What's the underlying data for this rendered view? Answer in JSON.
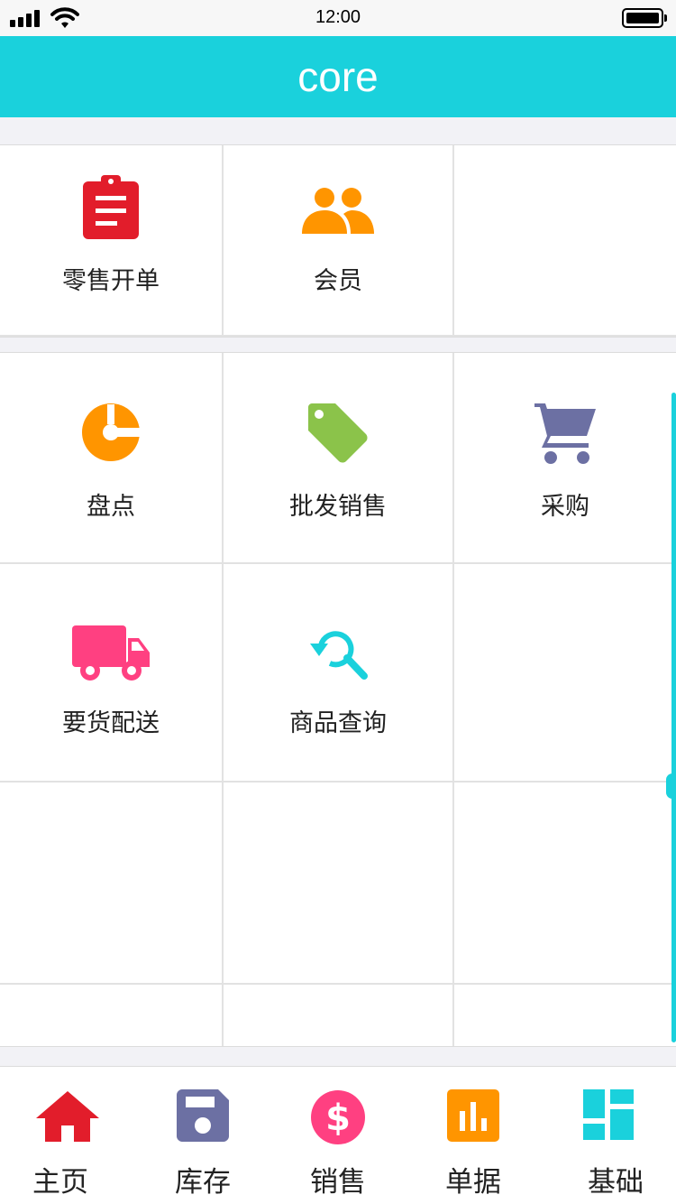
{
  "status_bar": {
    "time": "12:00",
    "battery_icon": "battery-icon",
    "signal_icon": "signal-icon",
    "wifi_icon": "wifi-icon"
  },
  "header": {
    "title": "core"
  },
  "colors": {
    "accent": "#1ad1dc",
    "red": "#e21d2b",
    "orange": "#ff9500",
    "green": "#8bc34a",
    "slate": "#6c70a3",
    "pink": "#ff4081"
  },
  "sections": [
    {
      "items": [
        {
          "label": "零售开单",
          "icon": "clipboard-icon"
        },
        {
          "label": "会员",
          "icon": "members-icon"
        },
        {
          "label": "",
          "icon": ""
        }
      ]
    },
    {
      "items": [
        {
          "label": "盘点",
          "icon": "inventory-check-icon"
        },
        {
          "label": "批发销售",
          "icon": "tag-icon"
        },
        {
          "label": "采购",
          "icon": "cart-icon"
        },
        {
          "label": "要货配送",
          "icon": "truck-icon"
        },
        {
          "label": "商品查询",
          "icon": "search-refresh-icon"
        }
      ]
    }
  ],
  "tabbar": {
    "items": [
      {
        "label": "主页",
        "icon": "home-icon"
      },
      {
        "label": "库存",
        "icon": "save-icon"
      },
      {
        "label": "销售",
        "icon": "dollar-icon"
      },
      {
        "label": "单据",
        "icon": "bar-chart-icon"
      },
      {
        "label": "基础",
        "icon": "dashboard-icon"
      }
    ]
  }
}
